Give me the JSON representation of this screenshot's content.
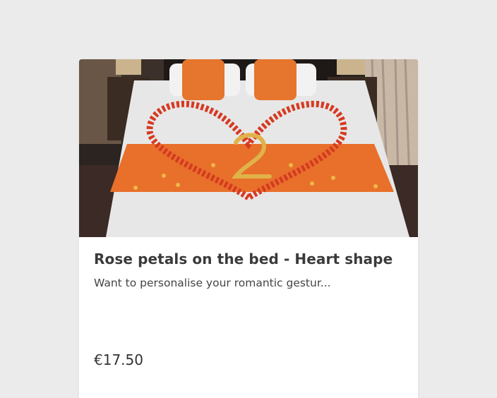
{
  "product": {
    "image_alt": "Rose petals on the bed - Heart shape",
    "title": "Rose petals on the bed - Heart shape",
    "description": "Want to personalise your romantic gestur...",
    "price": "€17.50"
  },
  "colors": {
    "background": "#ebebeb",
    "card": "#ffffff",
    "title_text": "#3a3a3a",
    "accent_orange": "#e8702a",
    "petal_red": "#d63a22"
  }
}
